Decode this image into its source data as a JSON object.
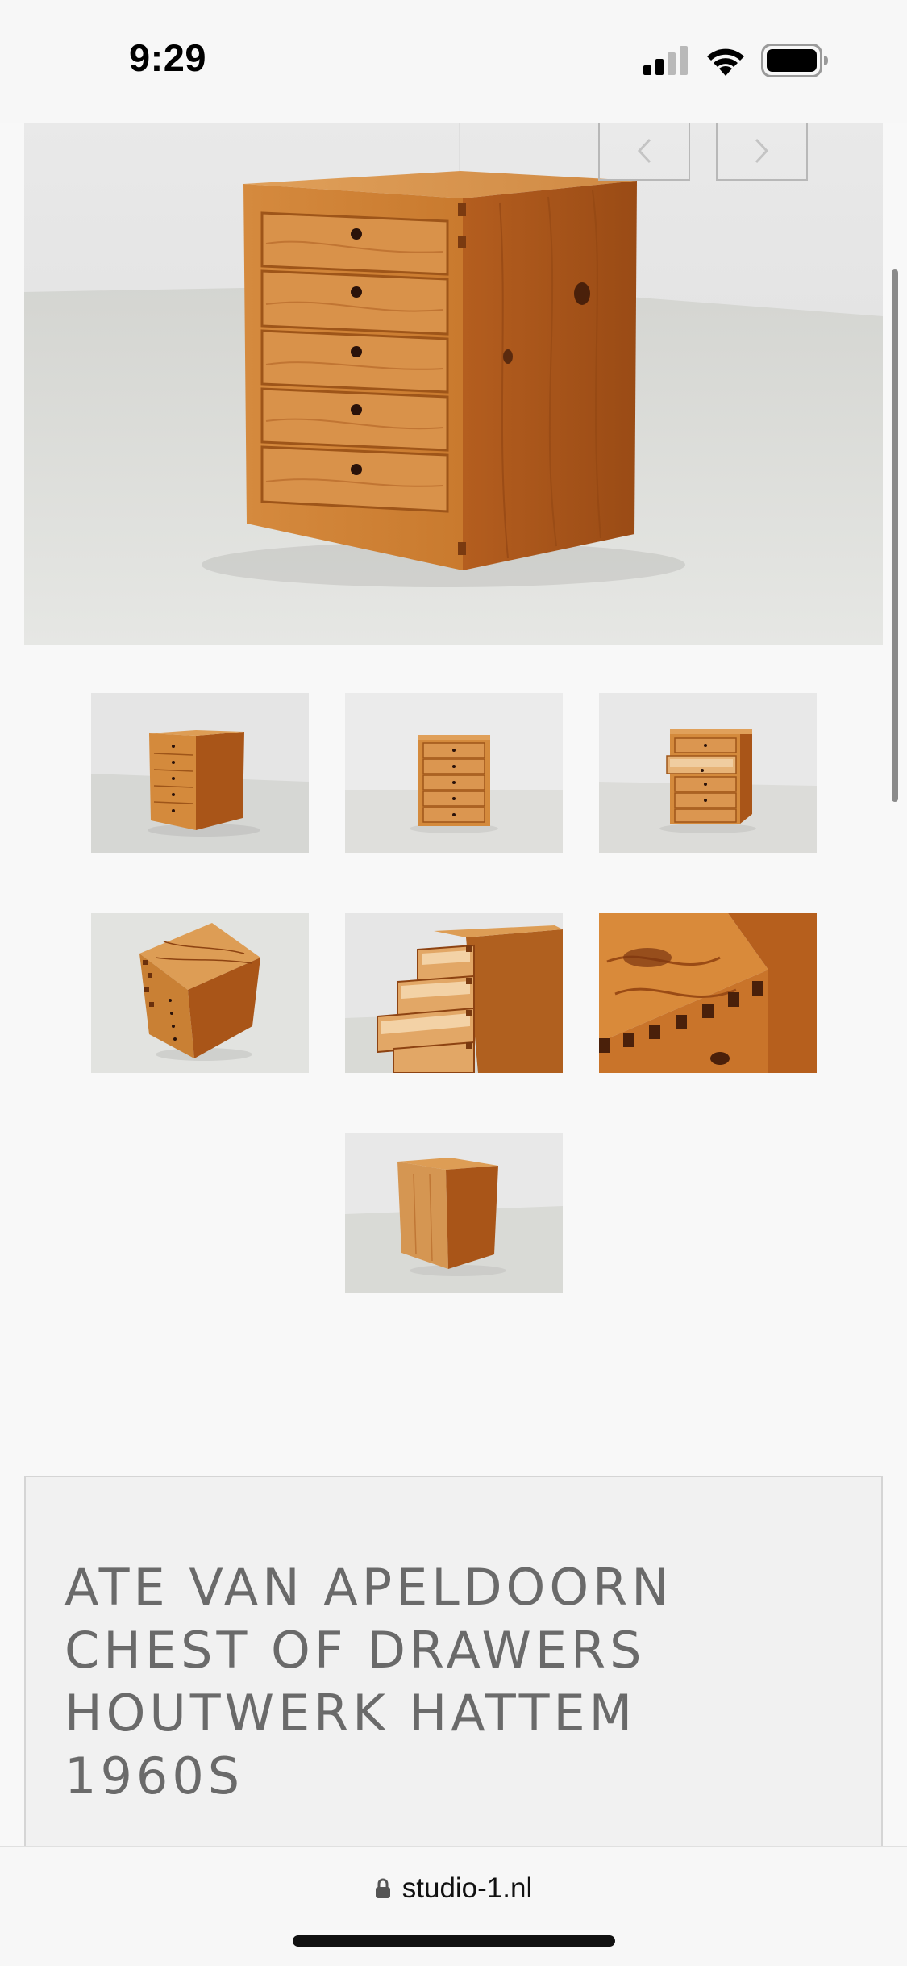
{
  "status_bar": {
    "time": "9:29",
    "icons": [
      "cellular-signal-icon",
      "wifi-icon",
      "battery-icon"
    ]
  },
  "gallery": {
    "prev_icon": "chevron-left-icon",
    "next_icon": "chevron-right-icon",
    "thumbnails": [
      "chest-angled-view",
      "chest-front-view",
      "chest-open-drawer-view",
      "chest-top-view",
      "chest-open-drawers-detail",
      "chest-dovetail-detail",
      "chest-back-view"
    ]
  },
  "product": {
    "title_lines": [
      "ATE VAN APELDOORN",
      "CHEST OF DRAWERS",
      "HOUTWERK HATTEM",
      "1960S"
    ]
  },
  "browser": {
    "url": "studio-1.nl",
    "lock_icon": "lock-icon"
  },
  "colors": {
    "background": "#f8f8f8",
    "title_text": "#6a6a6a",
    "wood": "#c8762c"
  }
}
